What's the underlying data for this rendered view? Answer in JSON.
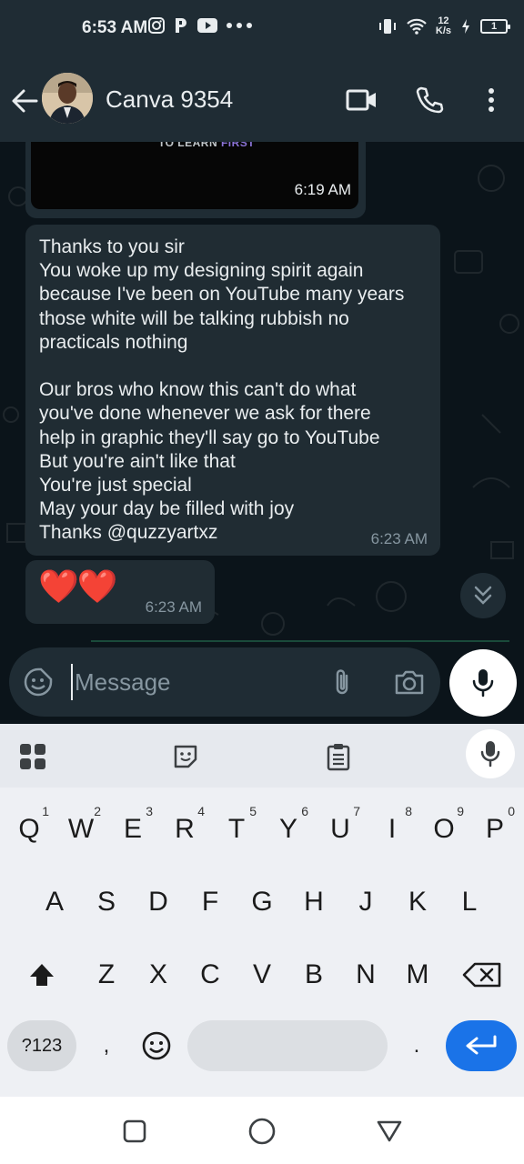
{
  "status_bar": {
    "time": "6:53 AM",
    "left_icons": [
      "instagram-icon",
      "p-app-icon",
      "youtube-icon",
      "more-dots-icon"
    ],
    "net_speed_value": "12",
    "net_speed_unit": "K/s",
    "battery_level": "1"
  },
  "header": {
    "contact_name": "Canva 9354",
    "icons": [
      "back-arrow-icon",
      "video-call-icon",
      "voice-call-icon",
      "more-options-icon"
    ]
  },
  "chat": {
    "media_message": {
      "caption_prefix": "TO LEARN ",
      "caption_accent": "FIRST",
      "time": "6:19 AM"
    },
    "text_message": {
      "text": "Thanks to you sir\nYou woke up my designing spirit again\nbecause I've been on YouTube many years\nthose white will be talking rubbish no\npracticals nothing\n\nOur bros who know this can't do what\nyou've done whenever we ask for there\nhelp in graphic they'll say go to YouTube\nBut you're ain't like that\nYou're just special\nMay your day be filled with joy\nThanks @quzzyartxz",
      "time": "6:23 AM"
    },
    "emoji_message": {
      "emoji": "❤️❤️",
      "time": "6:23 AM"
    }
  },
  "composer": {
    "placeholder": "Message",
    "icons": [
      "sticker-icon",
      "attach-icon",
      "camera-icon",
      "mic-icon"
    ]
  },
  "keyboard": {
    "toolbar_icons": [
      "apps-grid-icon",
      "sticker-icon",
      "clipboard-icon",
      "mic-icon"
    ],
    "row1": [
      {
        "key": "Q",
        "hint": "1"
      },
      {
        "key": "W",
        "hint": "2"
      },
      {
        "key": "E",
        "hint": "3"
      },
      {
        "key": "R",
        "hint": "4"
      },
      {
        "key": "T",
        "hint": "5"
      },
      {
        "key": "Y",
        "hint": "6"
      },
      {
        "key": "U",
        "hint": "7"
      },
      {
        "key": "I",
        "hint": "8"
      },
      {
        "key": "O",
        "hint": "9"
      },
      {
        "key": "P",
        "hint": "0"
      }
    ],
    "row2": [
      "A",
      "S",
      "D",
      "F",
      "G",
      "H",
      "J",
      "K",
      "L"
    ],
    "row3": [
      "Z",
      "X",
      "C",
      "V",
      "B",
      "N",
      "M"
    ],
    "symbols_label": "?123",
    "comma": ",",
    "period": "."
  },
  "navbar": {
    "icons": [
      "recents-square-icon",
      "home-circle-icon",
      "back-triangle-icon"
    ]
  },
  "colors": {
    "chat_bg": "#0b141a",
    "bubble_bg": "#202c33",
    "header_bg": "#1f2c34",
    "timestamp": "#8696a0",
    "keyboard_bg": "#eef0f4",
    "enter_key": "#1a73e8"
  }
}
